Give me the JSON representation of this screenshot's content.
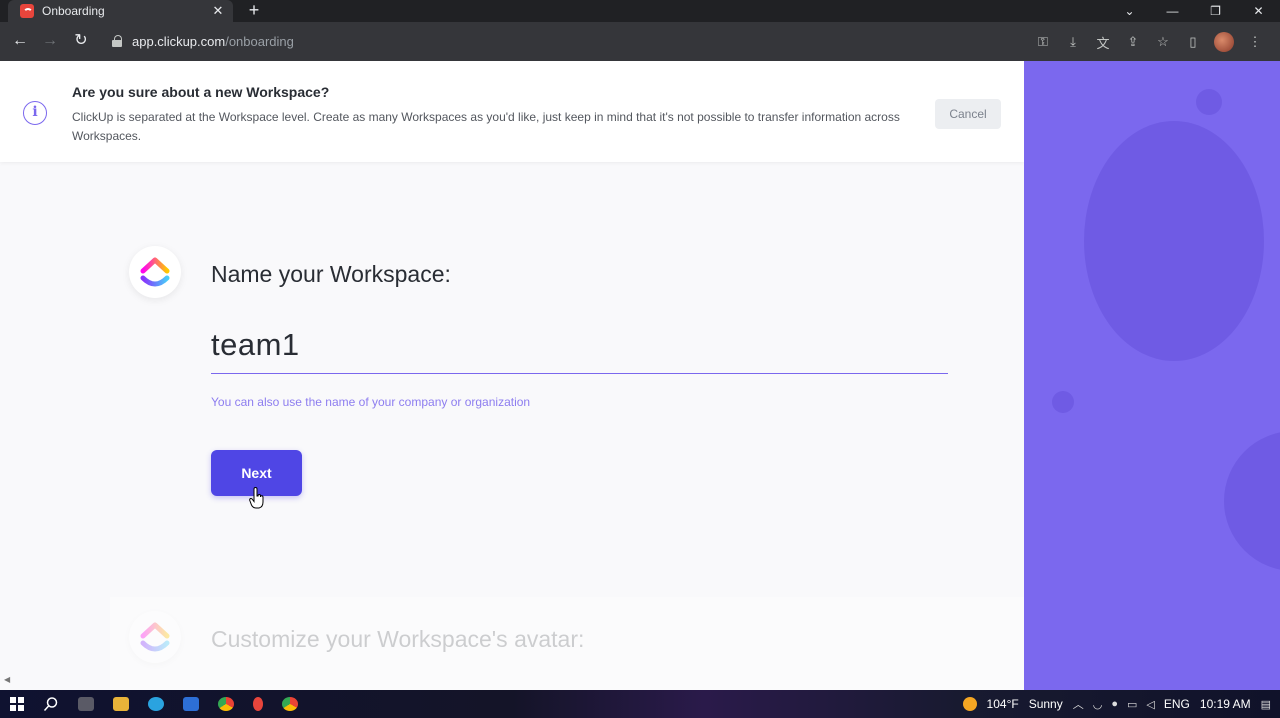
{
  "browser": {
    "tab_title": "Onboarding",
    "tab_close": "✕",
    "new_tab": "+",
    "url_host": "app.clickup.com",
    "url_path": "/onboarding",
    "window_controls": {
      "tab_search": "⌄",
      "minimize": "—",
      "restore": "❐",
      "close": "✕"
    },
    "nav": {
      "back": "←",
      "forward": "→",
      "reload": "↻"
    },
    "toolbar_icons": [
      "key-icon",
      "install-icon",
      "translate-icon",
      "share-icon",
      "bookmark-star-icon",
      "sidepanel-icon",
      "profile-avatar",
      "menu-icon"
    ]
  },
  "banner": {
    "title": "Are you sure about a new Workspace?",
    "text": "ClickUp is separated at the Workspace level. Create as many Workspaces as you'd like, just keep in mind that it's not possible to transfer information across Workspaces.",
    "cancel_label": "Cancel",
    "icon": "info-icon"
  },
  "step1": {
    "title": "Name your Workspace:",
    "input_value": "team1",
    "hint": "You can also use the name of your company or organization",
    "next_label": "Next"
  },
  "step2": {
    "title": "Customize your Workspace's avatar:"
  },
  "taskbar": {
    "temperature": "104°F",
    "weather": "Sunny",
    "language": "ENG",
    "time": "10:19 AM"
  },
  "colors": {
    "accent": "#7b68ee",
    "button": "#4f46e5",
    "side_panel": "#7b68ee"
  }
}
